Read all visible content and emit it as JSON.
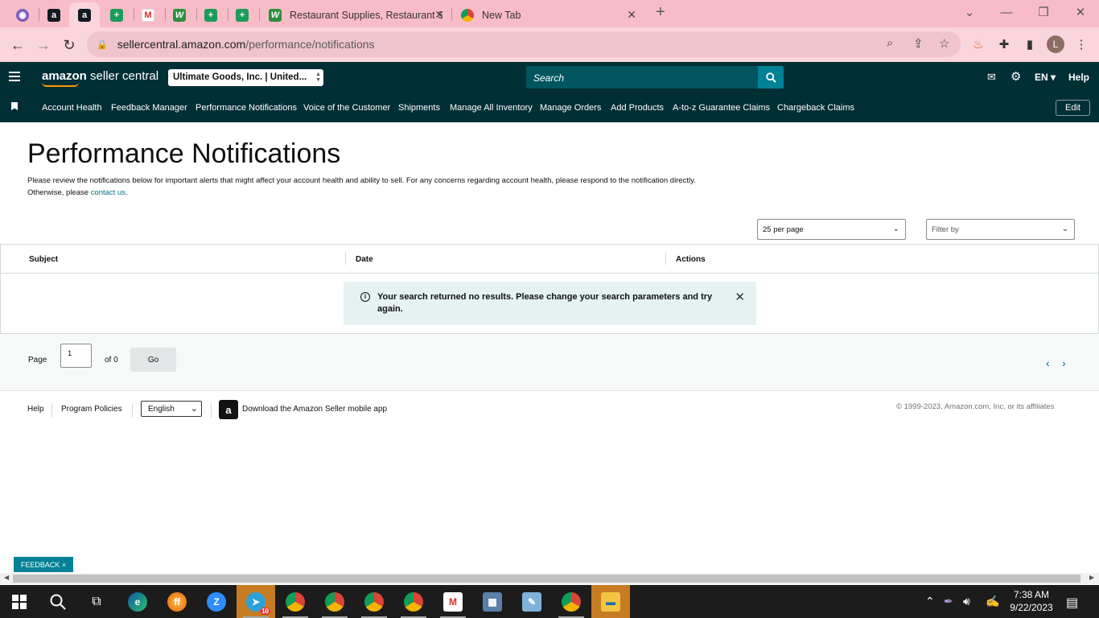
{
  "browser": {
    "tabs": [
      {
        "title": "",
        "icon": "twitch-icon"
      },
      {
        "title": "",
        "icon": "amazon-icon"
      },
      {
        "title": "",
        "icon": "amazon-icon"
      },
      {
        "title": "",
        "icon": "sheets-icon"
      },
      {
        "title": "",
        "icon": "gmail-icon"
      },
      {
        "title": "",
        "icon": "webstaurant-icon"
      },
      {
        "title": "",
        "icon": "sheets-icon"
      },
      {
        "title": "",
        "icon": "sheets-icon"
      },
      {
        "title": "Restaurant Supplies, Restaurant S",
        "icon": "webstaurant-icon"
      },
      {
        "title": "New Tab",
        "icon": "chrome-icon"
      }
    ],
    "url_host": "sellercentral.amazon.com",
    "url_path": "/performance/notifications",
    "profile_initial": "L"
  },
  "header": {
    "logo_brand": "amazon",
    "logo_product": " seller central",
    "account_selector": "Ultimate Goods, Inc. | United...",
    "search_placeholder": "Search",
    "language": "EN",
    "help": "Help"
  },
  "nav": {
    "items": [
      "Account Health",
      "Feedback Manager",
      "Performance Notifications",
      "Voice of the Customer",
      "Shipments",
      "Manage All Inventory",
      "Manage Orders",
      "Add Products",
      "A-to-z Guarantee Claims",
      "Chargeback Claims"
    ],
    "edit": "Edit"
  },
  "page": {
    "title": "Performance Notifications",
    "intro": "Please review the notifications below for important alerts that might affect your account health and ability to sell. For any concerns regarding account health, please respond to the notification directly. Otherwise, please ",
    "intro_link": "contact us",
    "intro_end": ".",
    "per_page": "25 per page",
    "filter": "Filter by"
  },
  "table": {
    "columns": [
      "Subject",
      "Date",
      "Actions"
    ],
    "empty_message": "Your search returned no results. Please change your search parameters and try again."
  },
  "pager": {
    "page_label": "Page",
    "page_value": "1",
    "of_label": "of 0",
    "go": "Go"
  },
  "footer": {
    "help": "Help",
    "policies": "Program Policies",
    "language": "English",
    "app_link": "Download the Amazon Seller mobile app",
    "copyright": "© 1999-2023, Amazon.com, Inc. or its affiliates"
  },
  "feedback": "FEEDBACK ×",
  "taskbar": {
    "time": "7:38 AM",
    "date": "9/22/2023",
    "badge": "10"
  }
}
